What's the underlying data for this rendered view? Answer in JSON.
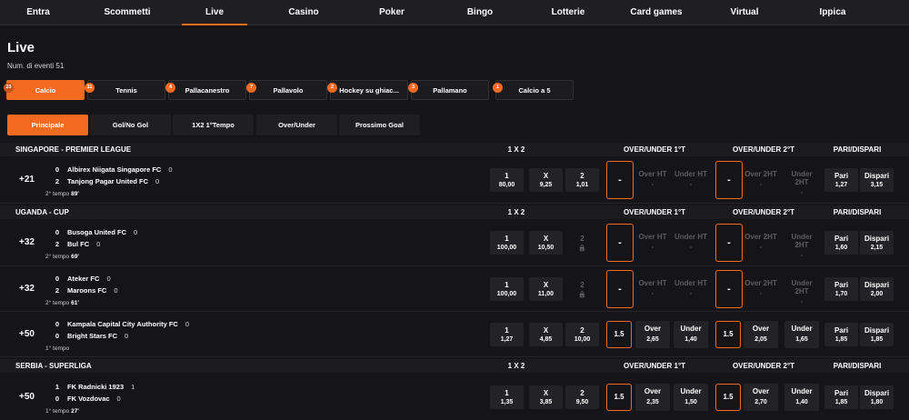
{
  "nav": [
    {
      "label": "Entra",
      "active": false
    },
    {
      "label": "Scommetti",
      "active": false
    },
    {
      "label": "Live",
      "active": true
    },
    {
      "label": "Casino",
      "active": false
    },
    {
      "label": "Poker",
      "active": false
    },
    {
      "label": "Bingo",
      "active": false
    },
    {
      "label": "Lotterie",
      "active": false
    },
    {
      "label": "Card games",
      "active": false
    },
    {
      "label": "Virtual",
      "active": false
    },
    {
      "label": "Ippica",
      "active": false
    }
  ],
  "page": {
    "title": "Live",
    "event_count_label": "Num. di eventi",
    "event_count": "51"
  },
  "sports": [
    {
      "label": "Calcio",
      "count": "23",
      "active": true
    },
    {
      "label": "Tennis",
      "count": "11",
      "active": false
    },
    {
      "label": "Pallacanestro",
      "count": "4",
      "active": false
    },
    {
      "label": "Pallavolo",
      "count": "7",
      "active": false
    },
    {
      "label": "Hockey su ghiac...",
      "count": "2",
      "active": false
    },
    {
      "label": "Pallamano",
      "count": "3",
      "active": false
    },
    {
      "label": "Calcio a 5",
      "count": "1",
      "active": false
    }
  ],
  "market_tabs": [
    {
      "label": "Principale",
      "active": true
    },
    {
      "label": "Gol/No Gol",
      "active": false
    },
    {
      "label": "1X2 1°Tempo",
      "active": false
    },
    {
      "label": "Over/Under",
      "active": false
    },
    {
      "label": "Prossimo Goal",
      "active": false
    }
  ],
  "column_headers": {
    "h1x2": "1 X 2",
    "ou1": "OVER/UNDER 1°T",
    "ou2": "OVER/UNDER 2°T",
    "pd": "PARI/DISPARI"
  },
  "leagues": [
    {
      "name": "SINGAPORE - PREMIER LEAGUE",
      "matches": [
        {
          "plus": "+21",
          "teams": [
            {
              "score": "0",
              "name": "Albirex Niigata Singapore FC",
              "ht": "0"
            },
            {
              "score": "2",
              "name": "Tanjong Pagar United FC",
              "ht": "0"
            }
          ],
          "period": "2° tempo",
          "minute": "89'",
          "odds": [
            {
              "k": "1",
              "v": "80,00",
              "on": true
            },
            {
              "k": "X",
              "v": "9,25",
              "on": true
            },
            {
              "k": "2",
              "v": "1,01",
              "on": true
            }
          ],
          "ou1": {
            "line": "-",
            "over_k": "Over HT",
            "over_v": "-",
            "under_k": "Under HT",
            "under_v": "-",
            "on": false
          },
          "ou2": {
            "line": "-",
            "over_k": "Over 2HT",
            "over_v": "-",
            "under_k": "Under 2HT",
            "under_v": "-",
            "on": false
          },
          "pd": [
            {
              "k": "Pari",
              "v": "1,27"
            },
            {
              "k": "Dispari",
              "v": "3,15"
            }
          ]
        }
      ]
    },
    {
      "name": "UGANDA - CUP",
      "matches": [
        {
          "plus": "+32",
          "teams": [
            {
              "score": "0",
              "name": "Busoga United FC",
              "ht": "0"
            },
            {
              "score": "2",
              "name": "Bul FC",
              "ht": "0"
            }
          ],
          "period": "2° tempo",
          "minute": "69'",
          "odds": [
            {
              "k": "1",
              "v": "100,00",
              "on": true
            },
            {
              "k": "X",
              "v": "10,50",
              "on": true
            },
            {
              "k": "2",
              "v": "",
              "on": false
            }
          ],
          "ou1": {
            "line": "-",
            "over_k": "Over HT",
            "over_v": "-",
            "under_k": "Under HT",
            "under_v": "-",
            "on": false
          },
          "ou2": {
            "line": "-",
            "over_k": "Over 2HT",
            "over_v": "-",
            "under_k": "Under 2HT",
            "under_v": "-",
            "on": false
          },
          "pd": [
            {
              "k": "Pari",
              "v": "1,60"
            },
            {
              "k": "Dispari",
              "v": "2,15"
            }
          ]
        },
        {
          "plus": "+32",
          "teams": [
            {
              "score": "0",
              "name": "Ateker FC",
              "ht": "0"
            },
            {
              "score": "2",
              "name": "Maroons FC",
              "ht": "0"
            }
          ],
          "period": "2° tempo",
          "minute": "61'",
          "odds": [
            {
              "k": "1",
              "v": "100,00",
              "on": true
            },
            {
              "k": "X",
              "v": "11,00",
              "on": true
            },
            {
              "k": "2",
              "v": "",
              "on": false
            }
          ],
          "ou1": {
            "line": "-",
            "over_k": "Over HT",
            "over_v": "-",
            "under_k": "Under HT",
            "under_v": "-",
            "on": false
          },
          "ou2": {
            "line": "-",
            "over_k": "Over 2HT",
            "over_v": "-",
            "under_k": "Under 2HT",
            "under_v": "-",
            "on": false
          },
          "pd": [
            {
              "k": "Pari",
              "v": "1,70"
            },
            {
              "k": "Dispari",
              "v": "2,00"
            }
          ]
        },
        {
          "plus": "+50",
          "teams": [
            {
              "score": "0",
              "name": "Kampala Capital City Authority FC",
              "ht": "0"
            },
            {
              "score": "0",
              "name": "Bright Stars FC",
              "ht": "0"
            }
          ],
          "period": "1° tempo",
          "minute": "",
          "odds": [
            {
              "k": "1",
              "v": "1,27",
              "on": true
            },
            {
              "k": "X",
              "v": "4,85",
              "on": true
            },
            {
              "k": "2",
              "v": "10,00",
              "on": true
            }
          ],
          "ou1": {
            "line": "1.5",
            "over_k": "Over",
            "over_v": "2,65",
            "under_k": "Under",
            "under_v": "1,40",
            "on": true
          },
          "ou2": {
            "line": "1.5",
            "over_k": "Over",
            "over_v": "2,05",
            "under_k": "Under",
            "under_v": "1,65",
            "on": true
          },
          "pd": [
            {
              "k": "Pari",
              "v": "1,85"
            },
            {
              "k": "Dispari",
              "v": "1,85"
            }
          ]
        }
      ]
    },
    {
      "name": "SERBIA - SUPERLIGA",
      "matches": [
        {
          "plus": "+50",
          "teams": [
            {
              "score": "1",
              "name": "FK Radnicki 1923",
              "ht": "1"
            },
            {
              "score": "0",
              "name": "FK Vozdovac",
              "ht": "0"
            }
          ],
          "period": "1° tempo",
          "minute": "27'",
          "odds": [
            {
              "k": "1",
              "v": "1,35",
              "on": true
            },
            {
              "k": "X",
              "v": "3,85",
              "on": true
            },
            {
              "k": "2",
              "v": "9,50",
              "on": true
            }
          ],
          "ou1": {
            "line": "1.5",
            "over_k": "Over",
            "over_v": "2,35",
            "under_k": "Under",
            "under_v": "1,50",
            "on": true
          },
          "ou2": {
            "line": "1.5",
            "over_k": "Over",
            "over_v": "2,70",
            "under_k": "Under",
            "under_v": "1,40",
            "on": true
          },
          "pd": [
            {
              "k": "Pari",
              "v": "1,85"
            },
            {
              "k": "Dispari",
              "v": "1,80"
            }
          ]
        }
      ]
    }
  ],
  "icons": {
    "lock": "lock-icon"
  },
  "colors": {
    "accent": "#f26b21",
    "background": "#151518",
    "panel": "#1f1f22"
  }
}
